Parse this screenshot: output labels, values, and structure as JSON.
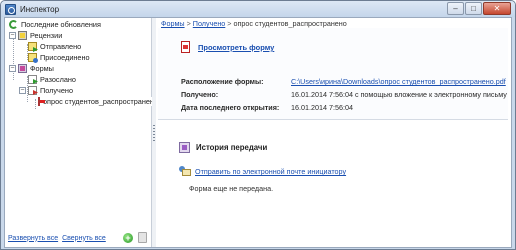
{
  "window": {
    "title": "Инспектор",
    "minimize": "–",
    "maximize": "□",
    "close": "✕"
  },
  "tree": {
    "latest": "Последние обновления",
    "reviews": "Рецензии",
    "reviews_sent": "Отправлено",
    "reviews_joined": "Присоединено",
    "forms": "Формы",
    "forms_sent": "Разослано",
    "forms_received": "Получено",
    "file": "опрос студентов_распространено",
    "collapse_glyph": "–"
  },
  "footer": {
    "expand_all": "Развернуть все",
    "collapse_all": "Свернуть все",
    "add": "+"
  },
  "breadcrumb": {
    "forms": "Формы",
    "received": "Получено",
    "sep": ">",
    "current": "опрос студентов_распространено"
  },
  "details": {
    "view_form": "Просмотреть форму",
    "location_label": "Расположение формы:",
    "location_value": "C:\\Users\\ирина\\Downloads\\опрос студентов_распространено.pdf",
    "received_label": "Получено:",
    "received_value": "16.01.2014 7:56:04 с помощью вложение к электронному письму",
    "last_opened_label": "Дата последнего открытия:",
    "last_opened_value": "16.01.2014 7:56:04"
  },
  "history": {
    "title": "История передачи",
    "email_link": "Отправить по электронной почте инициатору",
    "note": "Форма еще не передана."
  }
}
